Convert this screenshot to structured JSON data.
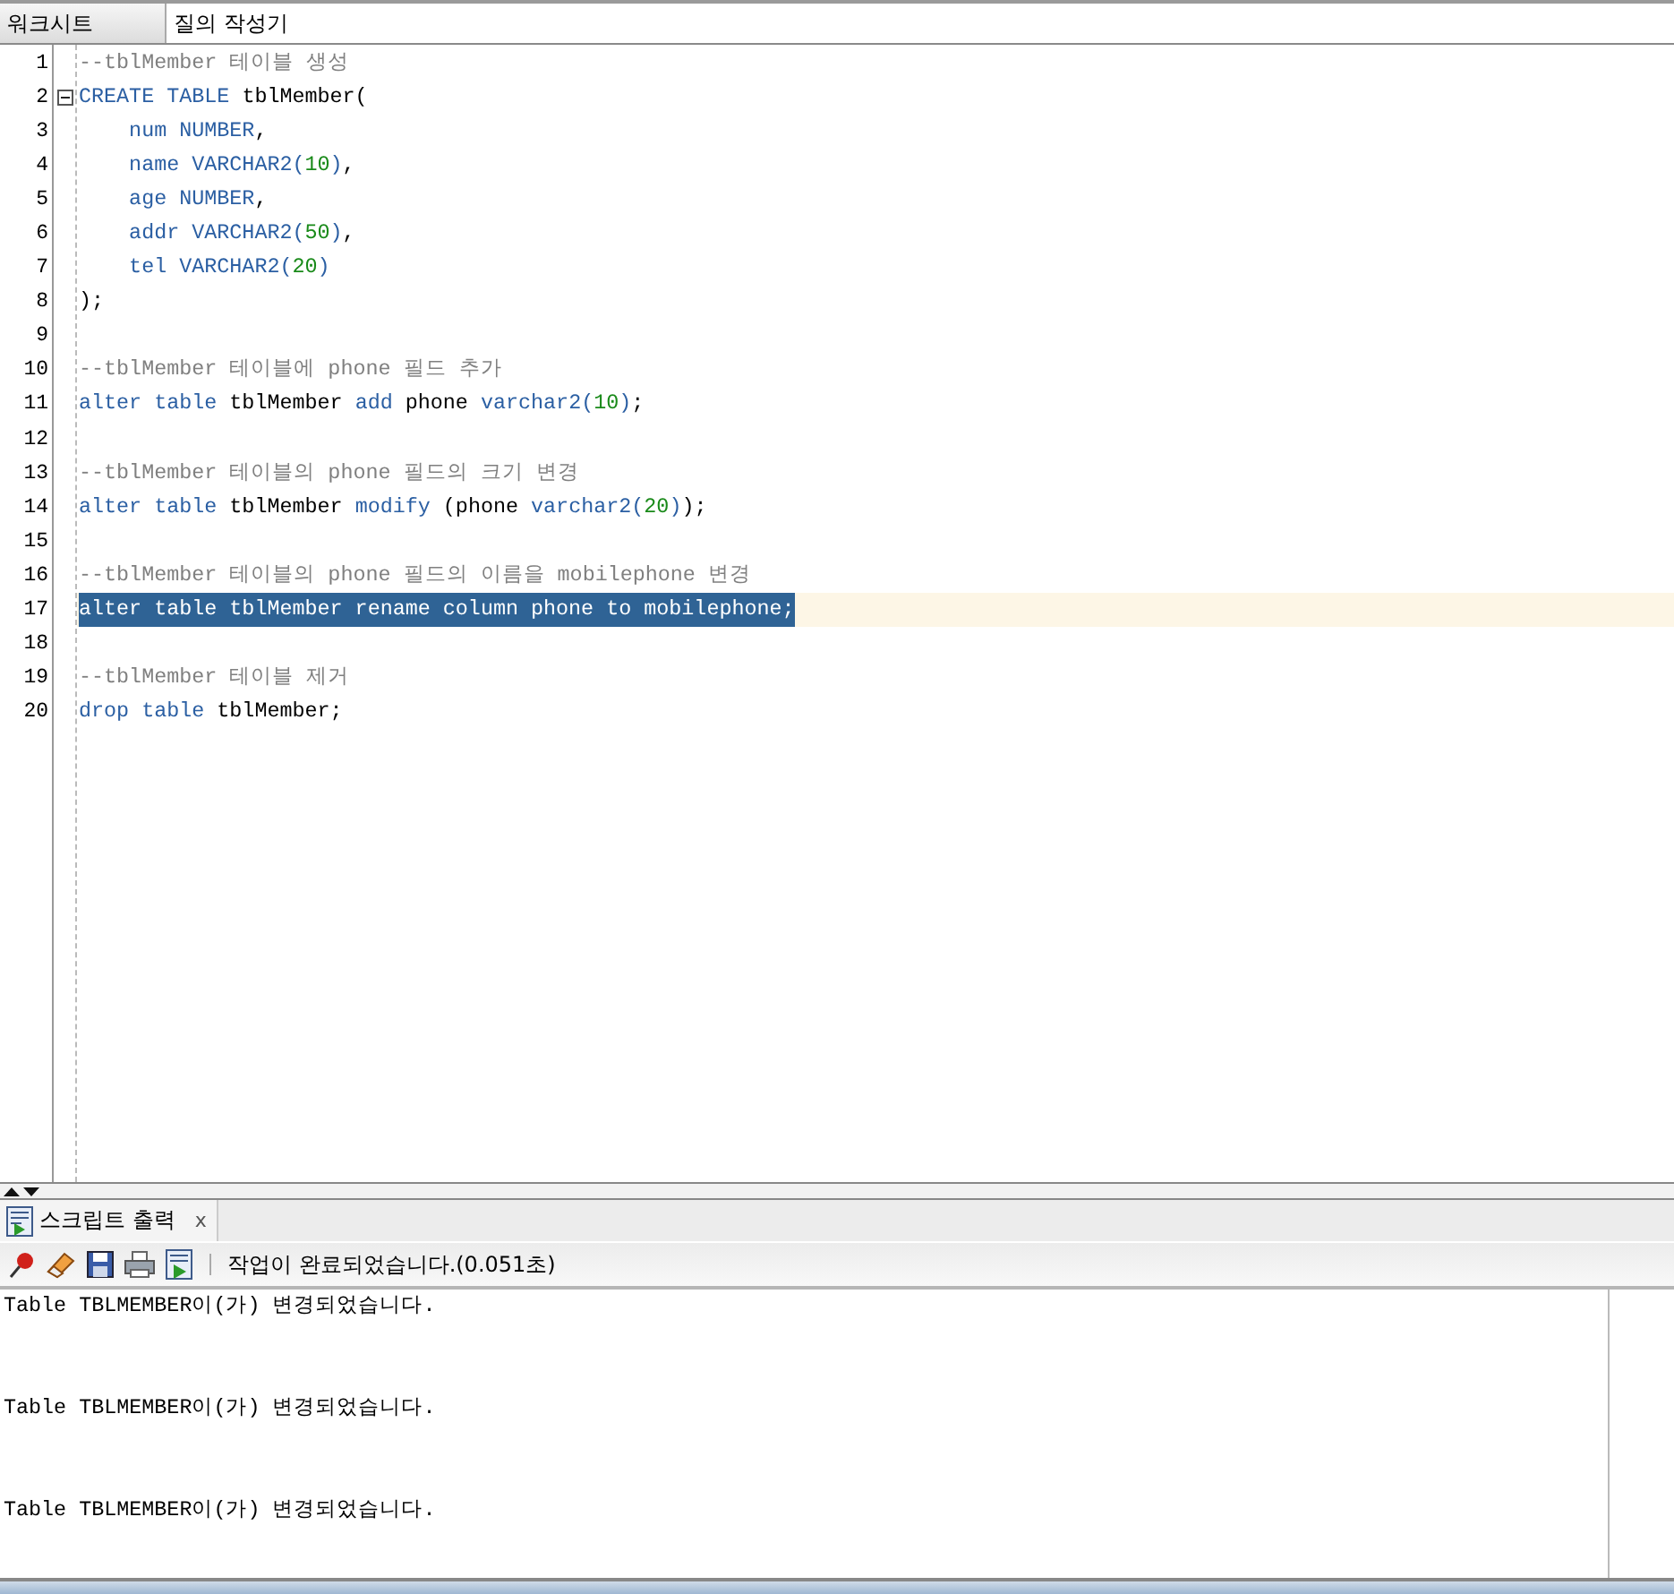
{
  "tabs": [
    {
      "label": "워크시트",
      "selected": true
    },
    {
      "label": "질의 작성기",
      "selected": false
    }
  ],
  "editor": {
    "lines": [
      {
        "number": "1",
        "fold": false,
        "selected": false,
        "tokens": [
          {
            "kind": "comment",
            "text": "--tblMember 테이블 생성"
          }
        ]
      },
      {
        "number": "2",
        "fold": true,
        "selected": false,
        "tokens": [
          {
            "kind": "keyword",
            "text": "CREATE TABLE "
          },
          {
            "kind": "plain",
            "text": "tblMember("
          }
        ]
      },
      {
        "number": "3",
        "fold": false,
        "selected": false,
        "tokens": [
          {
            "kind": "column",
            "text": "    num "
          },
          {
            "kind": "keyword",
            "text": "NUMBER"
          },
          {
            "kind": "plain",
            "text": ","
          }
        ]
      },
      {
        "number": "4",
        "fold": false,
        "selected": false,
        "tokens": [
          {
            "kind": "column",
            "text": "    name "
          },
          {
            "kind": "keyword",
            "text": "VARCHAR2("
          },
          {
            "kind": "number",
            "text": "10"
          },
          {
            "kind": "keyword",
            "text": ")"
          },
          {
            "kind": "plain",
            "text": ","
          }
        ]
      },
      {
        "number": "5",
        "fold": false,
        "selected": false,
        "tokens": [
          {
            "kind": "column",
            "text": "    age "
          },
          {
            "kind": "keyword",
            "text": "NUMBER"
          },
          {
            "kind": "plain",
            "text": ","
          }
        ]
      },
      {
        "number": "6",
        "fold": false,
        "selected": false,
        "tokens": [
          {
            "kind": "column",
            "text": "    addr "
          },
          {
            "kind": "keyword",
            "text": "VARCHAR2("
          },
          {
            "kind": "number",
            "text": "50"
          },
          {
            "kind": "keyword",
            "text": ")"
          },
          {
            "kind": "plain",
            "text": ","
          }
        ]
      },
      {
        "number": "7",
        "fold": false,
        "selected": false,
        "tokens": [
          {
            "kind": "column",
            "text": "    tel "
          },
          {
            "kind": "keyword",
            "text": "VARCHAR2("
          },
          {
            "kind": "number",
            "text": "20"
          },
          {
            "kind": "keyword",
            "text": ")"
          }
        ]
      },
      {
        "number": "8",
        "fold": false,
        "selected": false,
        "tokens": [
          {
            "kind": "plain",
            "text": ");"
          }
        ]
      },
      {
        "number": "9",
        "fold": false,
        "selected": false
      },
      {
        "number": "10",
        "fold": false,
        "selected": false,
        "tokens": [
          {
            "kind": "comment",
            "text": "--tblMember 테이블에 phone 필드 추가"
          }
        ]
      },
      {
        "number": "11",
        "fold": false,
        "selected": false,
        "tokens": [
          {
            "kind": "keyword",
            "text": "alter table "
          },
          {
            "kind": "plain",
            "text": "tblMember "
          },
          {
            "kind": "keyword",
            "text": "add "
          },
          {
            "kind": "plain",
            "text": "phone "
          },
          {
            "kind": "keyword",
            "text": "varchar2("
          },
          {
            "kind": "number",
            "text": "10"
          },
          {
            "kind": "keyword",
            "text": ")"
          },
          {
            "kind": "plain",
            "text": ";"
          }
        ]
      },
      {
        "number": "12",
        "fold": false,
        "selected": false
      },
      {
        "number": "13",
        "fold": false,
        "selected": false,
        "tokens": [
          {
            "kind": "comment",
            "text": "--tblMember 테이블의 phone 필드의 크기 변경"
          }
        ]
      },
      {
        "number": "14",
        "fold": false,
        "selected": false,
        "tokens": [
          {
            "kind": "keyword",
            "text": "alter table "
          },
          {
            "kind": "plain",
            "text": "tblMember "
          },
          {
            "kind": "keyword",
            "text": "modify "
          },
          {
            "kind": "plain",
            "text": "(phone "
          },
          {
            "kind": "keyword",
            "text": "varchar2("
          },
          {
            "kind": "number",
            "text": "20"
          },
          {
            "kind": "keyword",
            "text": ")"
          },
          {
            "kind": "plain",
            "text": ");"
          }
        ]
      },
      {
        "number": "15",
        "fold": false,
        "selected": false
      },
      {
        "number": "16",
        "fold": false,
        "selected": false,
        "tokens": [
          {
            "kind": "comment",
            "text": "--tblMember 테이블의 phone 필드의 이름을 mobilephone 변경"
          }
        ]
      },
      {
        "number": "17",
        "fold": false,
        "selected": true,
        "tokens": [
          {
            "kind": "keyword",
            "text": "alter table "
          },
          {
            "kind": "plain",
            "text": "tblMember rename column phone to mobilephone;"
          }
        ]
      },
      {
        "number": "18",
        "fold": false,
        "selected": false
      },
      {
        "number": "19",
        "fold": false,
        "selected": false,
        "tokens": [
          {
            "kind": "comment",
            "text": "--tblMember 테이블 제거"
          }
        ]
      },
      {
        "number": "20",
        "fold": false,
        "selected": false,
        "tokens": [
          {
            "kind": "keyword",
            "text": "drop table "
          },
          {
            "kind": "plain",
            "text": "tblMember;"
          }
        ]
      }
    ]
  },
  "output_panel": {
    "tab": {
      "label": "스크립트 출력",
      "close": "x"
    },
    "status": "작업이 완료되었습니다.(0.051초)",
    "lines": [
      "Table TBLMEMBER이(가) 변경되었습니다.",
      "Table TBLMEMBER이(가) 변경되었습니다.",
      "Table TBLMEMBER이(가) 변경되었습니다."
    ]
  }
}
